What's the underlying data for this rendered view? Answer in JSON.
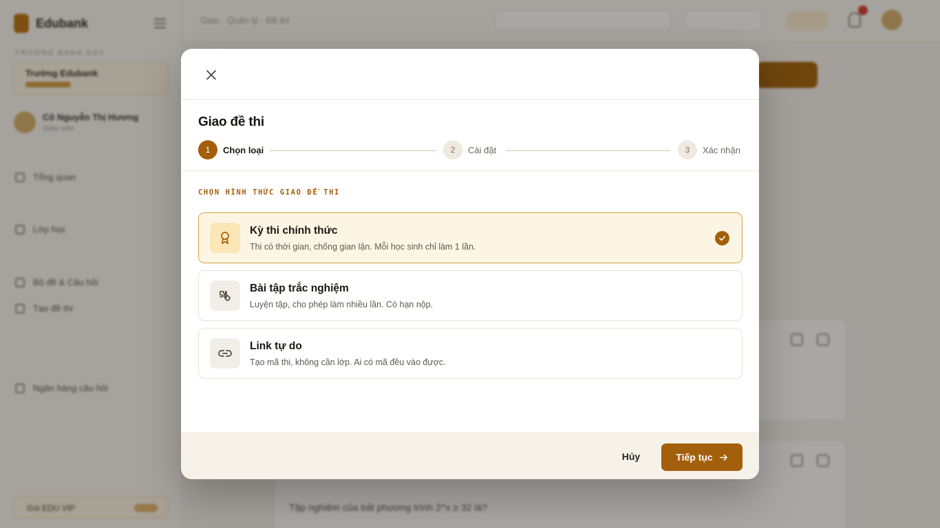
{
  "background": {
    "brand": "Edubank",
    "breadcrumb": "Giao · Quản lý · Đề thi",
    "school_label": "TRƯỜNG ĐANG DẠY",
    "school_name": "Trường Edubank",
    "user_name": "Cô Nguyễn Thị Hương",
    "user_role": "Giáo viên",
    "nav": [
      "Tổng quan",
      "Lớp học",
      "Bộ đề & Câu hỏi",
      "Tạo đề thi",
      "Ngân hàng câu hỏi"
    ],
    "bottom_label": "Gói EDU VIP",
    "main_text": "Tập nghiệm của bất phương trình 2^x ≥ 32 là?"
  },
  "modal": {
    "title": "Giao đề thi",
    "steps": [
      {
        "num": "1",
        "label": "Chọn loại",
        "active": true
      },
      {
        "num": "2",
        "label": "Cài đặt",
        "active": false
      },
      {
        "num": "3",
        "label": "Xác nhận",
        "active": false
      }
    ],
    "section_label": "CHỌN HÌNH THỨC GIAO ĐỀ THI",
    "options": [
      {
        "title": "Kỳ thi chính thức",
        "desc": "Thi có thời gian, chống gian lận. Mỗi học sinh chỉ làm 1 lần.",
        "icon": "award-icon",
        "selected": true
      },
      {
        "title": "Bài tập trắc nghiệm",
        "desc": "Luyện tập, cho phép làm nhiều lần. Có hạn nộp.",
        "icon": "puzzle-icon",
        "selected": false
      },
      {
        "title": "Link tự do",
        "desc": "Tạo mã thi, không cần lớp. Ai có mã đều vào được.",
        "icon": "link-icon",
        "selected": false
      }
    ],
    "cancel_label": "Hủy",
    "next_label": "Tiếp tục"
  },
  "colors": {
    "accent": "#a35f0b",
    "selected_bg": "#fdf5e4",
    "selected_border": "#d7a04a"
  }
}
